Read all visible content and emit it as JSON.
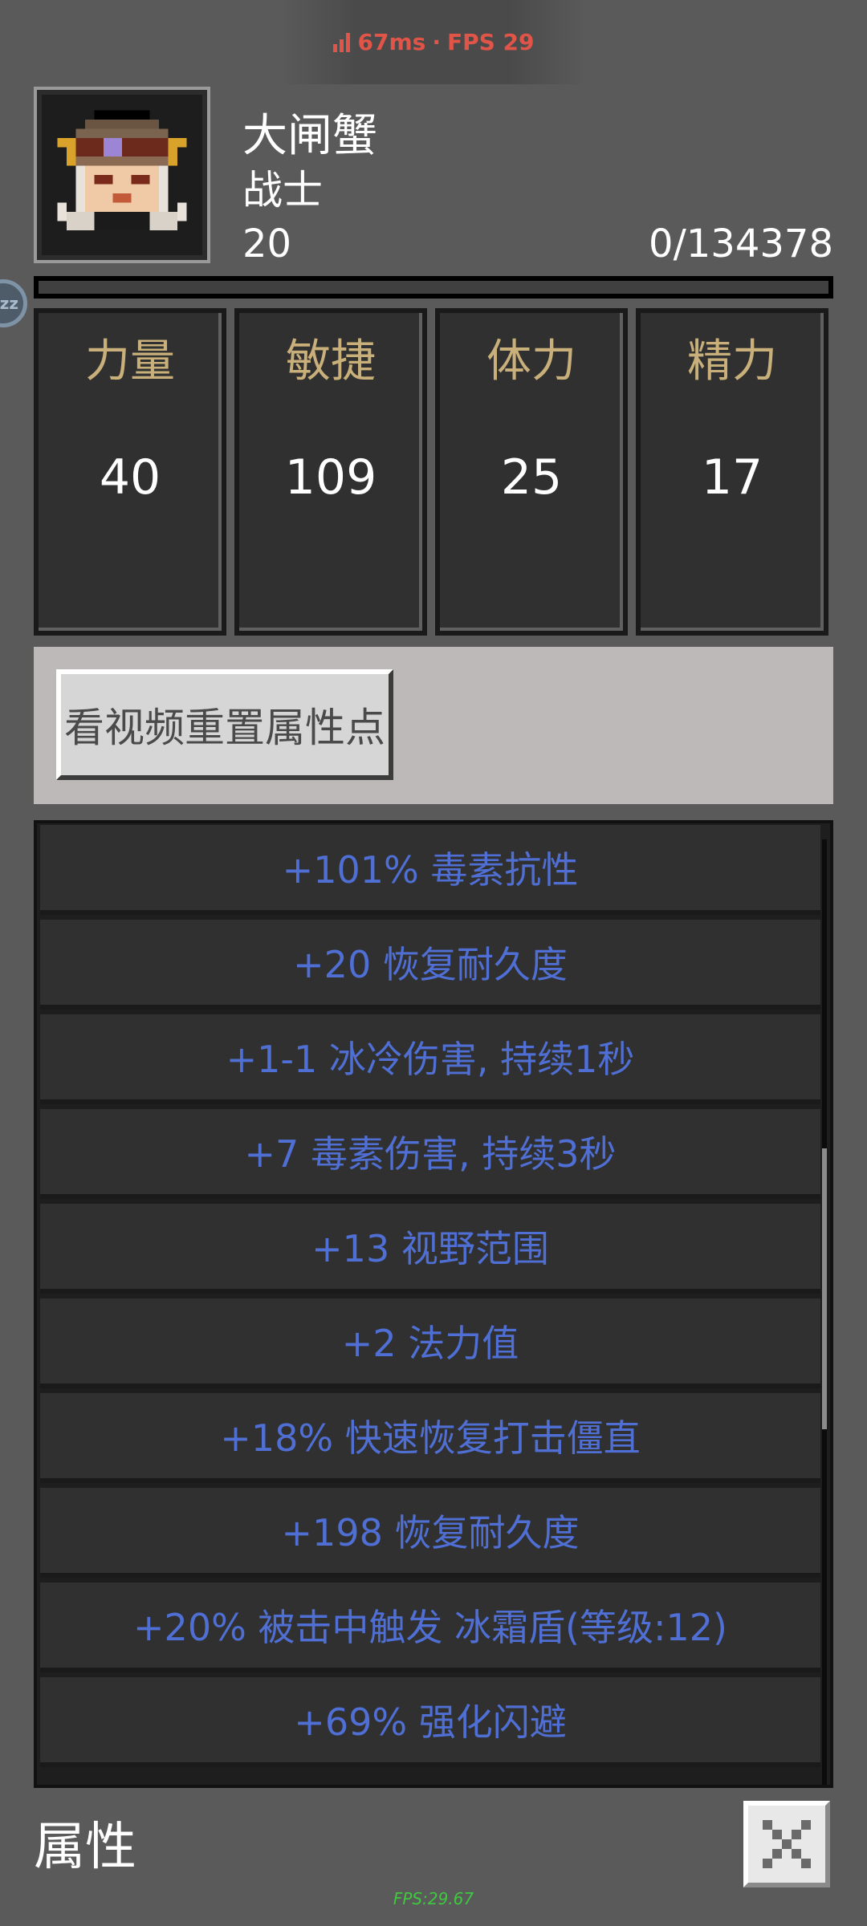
{
  "status_bar": {
    "ping": "67ms",
    "separator": "·",
    "fps": "FPS 29"
  },
  "hero": {
    "name": "大闸蟹",
    "class": "战士",
    "level": "20",
    "exp": "0/134378",
    "exp_progress": 0.0
  },
  "sleep_badge": "zz",
  "stats": [
    {
      "label": "力量",
      "value": "40"
    },
    {
      "label": "敏捷",
      "value": "109"
    },
    {
      "label": "体力",
      "value": "25"
    },
    {
      "label": "精力",
      "value": "17"
    }
  ],
  "reset_button": {
    "label": "看视频重置属性点"
  },
  "affixes": [
    "+101% 毒素抗性",
    "+20 恢复耐久度",
    "+1-1 冰冷伤害, 持续1秒",
    "+7 毒素伤害, 持续3秒",
    "+13 视野范围",
    "+2 法力值",
    "+18% 快速恢复打击僵直",
    "+198 恢复耐久度",
    "+20% 被击中触发 冰霜盾(等级:12)",
    "+69% 强化闪避"
  ],
  "page_title": "属性",
  "footer_fps": "FPS:29.67",
  "colors": {
    "background": "#5a5a5a",
    "stat_label": "#c9b07a",
    "affix_text": "#4f6fd4",
    "status_text": "#e05548",
    "fps_footer": "#3ec93e"
  },
  "icons": {
    "status": "signal-icon",
    "close": "close-icon",
    "avatar": "hero-avatar"
  }
}
